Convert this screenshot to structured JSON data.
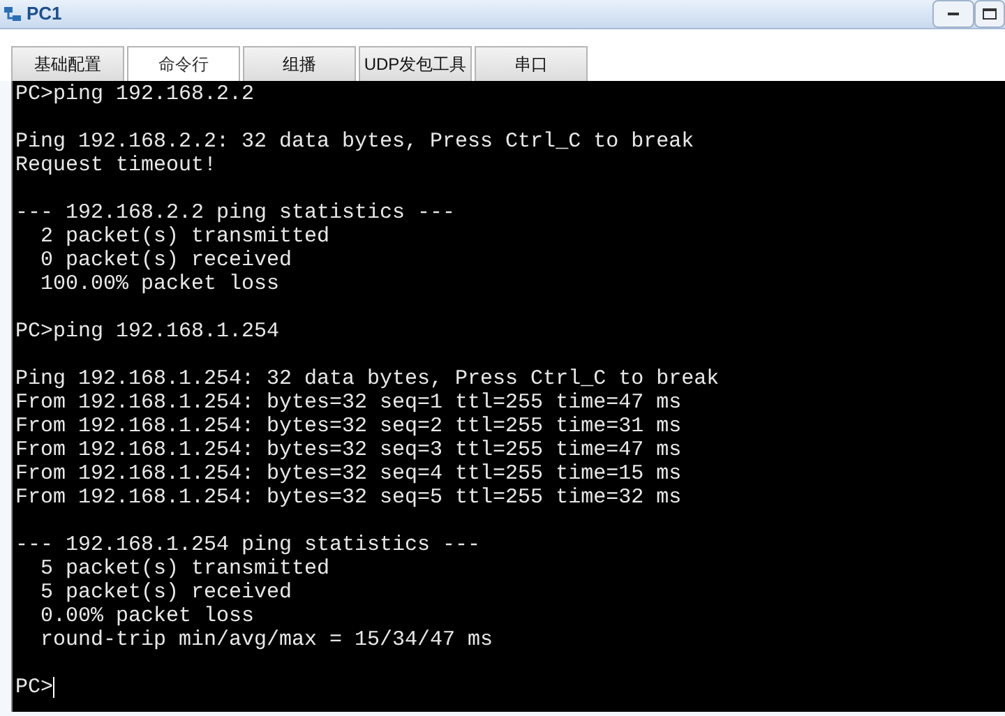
{
  "window": {
    "title": "PC1"
  },
  "tabs": [
    {
      "label": "基础配置",
      "selected": false
    },
    {
      "label": "命令行",
      "selected": true
    },
    {
      "label": "组播",
      "selected": false
    },
    {
      "label": "UDP发包工具",
      "selected": false
    },
    {
      "label": "串口",
      "selected": false
    }
  ],
  "terminal": {
    "blocks": [
      [
        "PC>ping 192.168.2.2"
      ],
      [
        "Ping 192.168.2.2: 32 data bytes, Press Ctrl_C to break",
        "Request timeout!"
      ],
      [
        "--- 192.168.2.2 ping statistics ---",
        "  2 packet(s) transmitted",
        "  0 packet(s) received",
        "  100.00% packet loss"
      ],
      [
        "PC>ping 192.168.1.254"
      ],
      [
        "Ping 192.168.1.254: 32 data bytes, Press Ctrl_C to break",
        "From 192.168.1.254: bytes=32 seq=1 ttl=255 time=47 ms",
        "From 192.168.1.254: bytes=32 seq=2 ttl=255 time=31 ms",
        "From 192.168.1.254: bytes=32 seq=3 ttl=255 time=47 ms",
        "From 192.168.1.254: bytes=32 seq=4 ttl=255 time=15 ms",
        "From 192.168.1.254: bytes=32 seq=5 ttl=255 time=32 ms"
      ],
      [
        "--- 192.168.1.254 ping statistics ---",
        "  5 packet(s) transmitted",
        "  5 packet(s) received",
        "  0.00% packet loss",
        "  round-trip min/avg/max = 15/34/47 ms"
      ]
    ],
    "prompt": "PC>"
  }
}
